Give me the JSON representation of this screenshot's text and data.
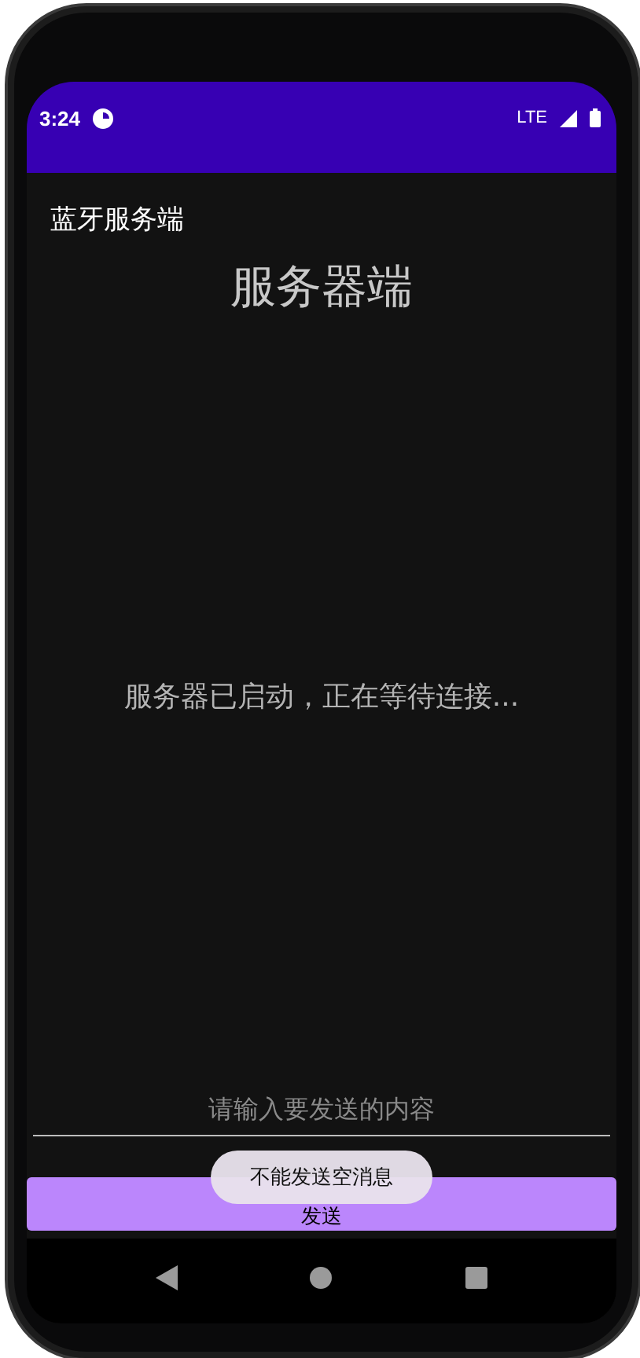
{
  "status_bar": {
    "time": "3:24",
    "network": "LTE"
  },
  "app_bar": {
    "title": "蓝牙服务端"
  },
  "heading": "服务器端",
  "status_message": "服务器已启动，正在等待连接...",
  "message_input": {
    "placeholder": "请输入要发送的内容"
  },
  "send_button": {
    "label": "发送"
  },
  "toast": {
    "text": "不能发送空消息"
  }
}
